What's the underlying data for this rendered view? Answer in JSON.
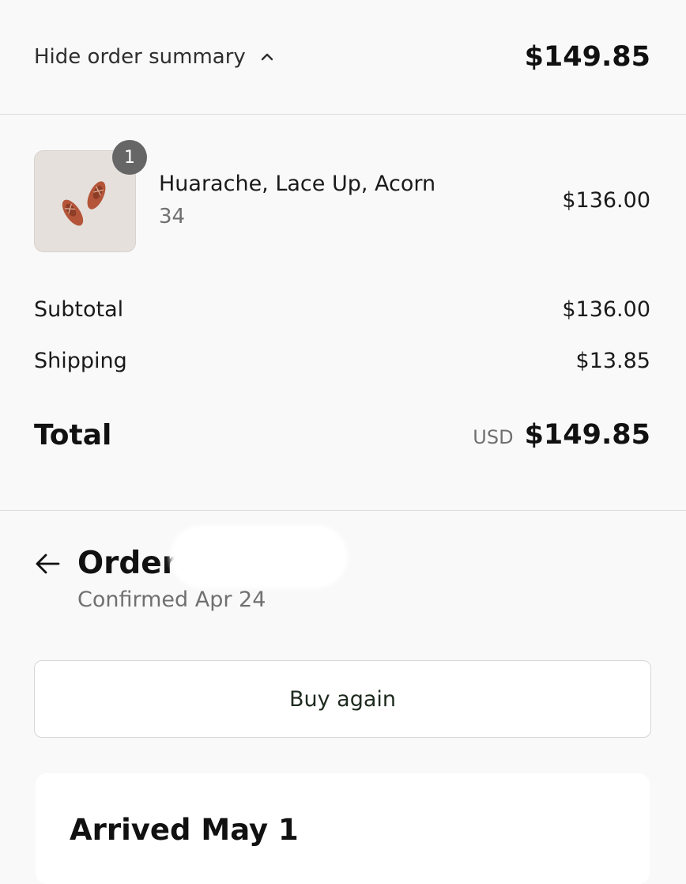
{
  "summary_toggle": {
    "label": "Hide order summary",
    "total": "$149.85"
  },
  "line_item": {
    "quantity": "1",
    "name": "Huarache, Lace Up, Acorn",
    "variant": "34",
    "price": "$136.00"
  },
  "totals": {
    "subtotal_label": "Subtotal",
    "subtotal_value": "$136.00",
    "shipping_label": "Shipping",
    "shipping_value": "$13.85",
    "total_label": "Total",
    "currency": "USD",
    "total_value": "$149.85"
  },
  "order": {
    "title": "Order",
    "hash": "#",
    "confirmed": "Confirmed Apr 24"
  },
  "actions": {
    "buy_again": "Buy again"
  },
  "status": {
    "title": "Arrived May 1"
  },
  "colors": {
    "page_background": "#f9f9f9",
    "badge": "#666666",
    "thumbnail_background": "#e5e0db",
    "shoe": "#b4553a"
  }
}
